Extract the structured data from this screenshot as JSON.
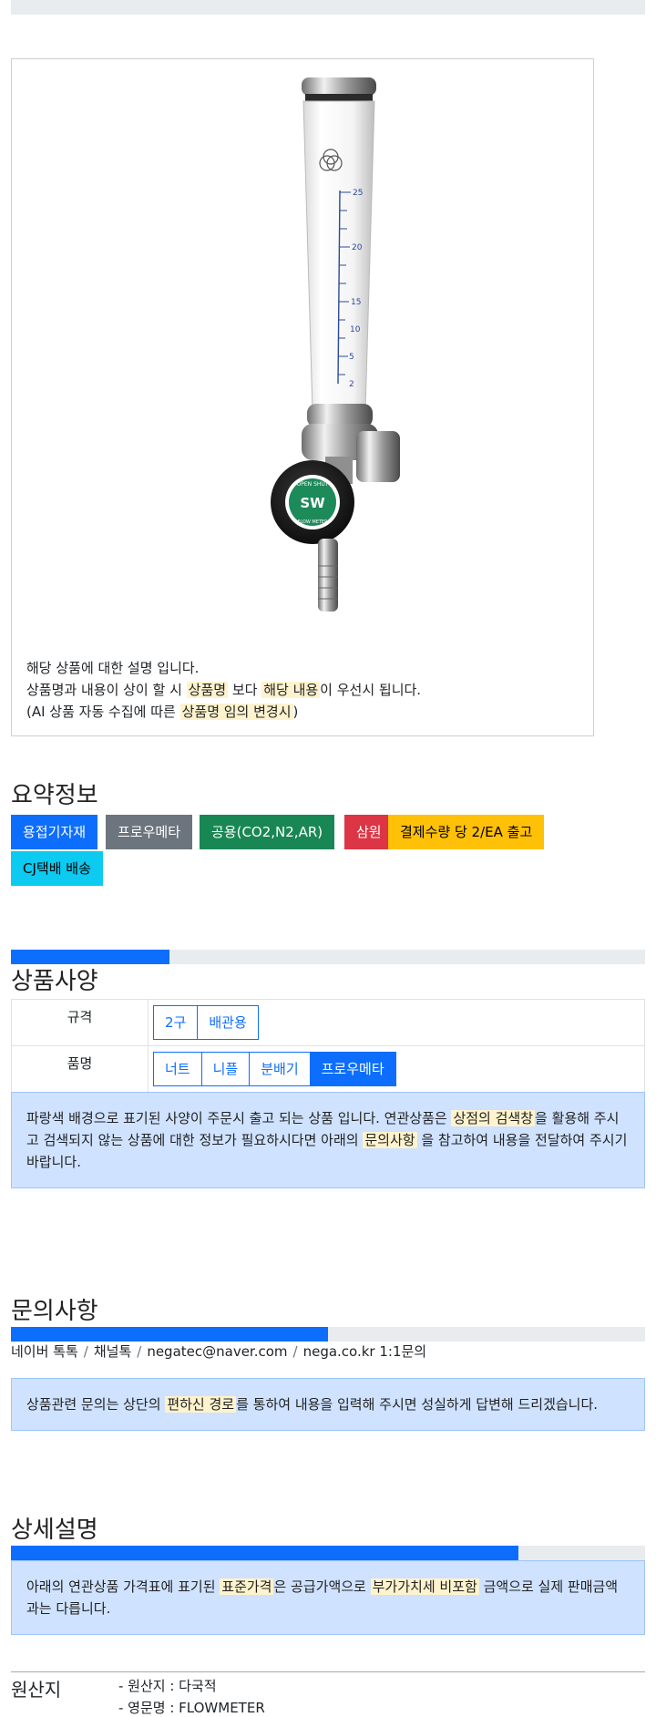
{
  "image_card": {
    "product_image_alt": "SW FLOW METER",
    "knob_text_center": "SW",
    "knob_text_ring": "OPEN SHUT",
    "knob_text_bottom": "FLOW METER",
    "scale_numbers": [
      "25",
      "20",
      "15",
      "10",
      "5",
      "2"
    ],
    "desc_line1": "해당 상품에 대한 설명 입니다.",
    "desc_line2_a": "상품명과 내용이 상이 할 시 ",
    "desc_line2_hl1": "상품명",
    "desc_line2_b": " 보다 ",
    "desc_line2_hl2": "해당 내용",
    "desc_line2_c": "이 우선시 됩니다.",
    "desc_line3_a": "(AI 상품 자동 수집에 따른 ",
    "desc_line3_hl": "상품명 임의 변경시",
    "desc_line3_b": ")"
  },
  "summary": {
    "title": "요약정보",
    "tags": [
      "용접기자재",
      "프로우메타",
      "공용(CO2,N2,AR)",
      "삼원",
      "결제수량 당 2/EA 출고",
      "CJ택배 배송"
    ]
  },
  "spec": {
    "progress": 0.25,
    "title": "상품사양",
    "rows": [
      {
        "label": "규격",
        "options": [
          "2구",
          "배관용"
        ],
        "selected": -1
      },
      {
        "label": "품명",
        "options": [
          "너트",
          "니플",
          "분배기",
          "프로우메타"
        ],
        "selected": 3
      }
    ],
    "note_a": "파랑색 배경으로 표기된 사양이 주문시 출고 되는 상품 입니다. 연관상품은 ",
    "note_hl1": "상점의 검색창",
    "note_b": "을 활용해 주시고 검색되지 않는 상품에 대한 정보가 필요하시다면 아래의 ",
    "note_hl2": "문의사항",
    "note_c": " 을 참고하여 내용을 전달하여 주시기 바랍니다."
  },
  "inquiry": {
    "title": "문의사항",
    "progress": 0.5,
    "links": [
      "네이버 톡톡",
      "채널톡",
      "negatec@naver.com",
      "nega.co.kr 1:1문의"
    ],
    "separator": "/",
    "note_a": "상품관련 문의는 상단의 ",
    "note_hl": "편하신 경로",
    "note_b": "를 통하여 내용을 입력해 주시면 성실하게 답변해 드리겠습니다."
  },
  "detail": {
    "title": "상세설명",
    "progress": 0.8,
    "note_a": "아래의 연관상품 가격표에 표기된 ",
    "note_hl1": "표준가격",
    "note_b": "은 공급가액으로 ",
    "note_hl2": "부가가치세 비포함",
    "note_c": " 금액으로 실제 판매금액과는 다릅니다."
  },
  "origin": {
    "label": "원산지",
    "items": [
      "- 원산지 : 다국적",
      "- 영문명 : FLOWMETER"
    ]
  },
  "colors": {
    "primary": "#0d6efd",
    "secondary": "#6c757d",
    "success": "#198754",
    "danger": "#dc3545",
    "warning": "#ffc107",
    "info": "#0dcaf0",
    "highlight": "#fff3cd",
    "alert_bg": "#cfe2ff"
  }
}
